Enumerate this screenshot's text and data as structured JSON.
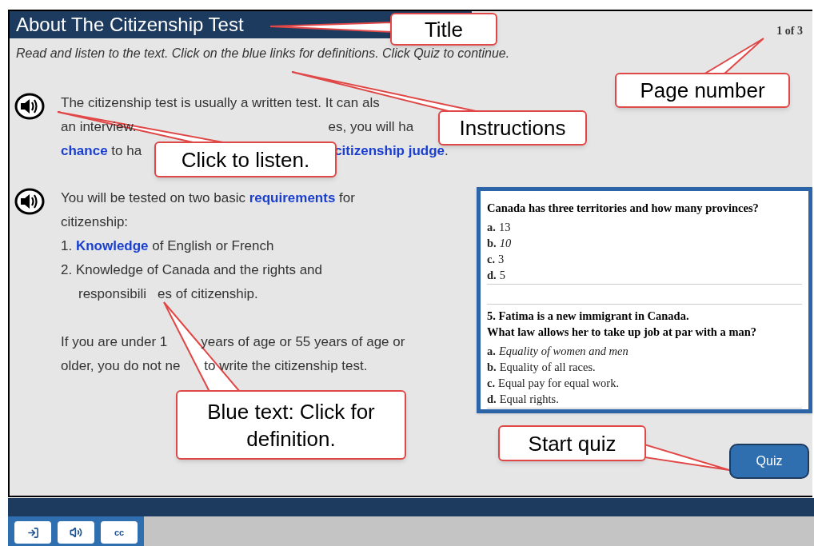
{
  "title": "About The Citizenship Test",
  "page_number": "1 of 3",
  "instructions": "Read and listen to the text. Click on the blue links for definitions. Click Quiz to continue.",
  "sections": [
    {
      "lines": [
        [
          {
            "kind": "text",
            "text": "The citizenship test is usually a written test. It can als"
          }
        ],
        [
          {
            "kind": "text",
            "text": "an interview."
          },
          {
            "kind": "text",
            "text": "es, you will ha"
          }
        ],
        [
          {
            "kind": "link",
            "text": "chance"
          },
          {
            "kind": "text",
            "text": " to ha"
          },
          {
            "kind": "link",
            "text": "citizenship judge"
          },
          {
            "kind": "text",
            "text": "."
          }
        ]
      ]
    },
    {
      "lines": [
        [
          {
            "kind": "text",
            "text": "You will be tested on two basic "
          },
          {
            "kind": "link",
            "text": "requirements"
          },
          {
            "kind": "text",
            "text": " for"
          }
        ],
        [
          {
            "kind": "text",
            "text": "citizenship:"
          }
        ],
        [
          {
            "kind": "text",
            "text": "1. "
          },
          {
            "kind": "link",
            "text": "Knowledge"
          },
          {
            "kind": "text",
            "text": " of English or French"
          }
        ],
        [
          {
            "kind": "text",
            "text": "2. Knowledge of Canada and the rights and"
          }
        ],
        [
          {
            "kind": "text",
            "text": "responsibili"
          },
          {
            "kind": "text",
            "text": "es of citizenship."
          }
        ],
        [
          {
            "kind": "text",
            "text": "If you are under 1"
          },
          {
            "kind": "text",
            "text": "years of age or 55 years of age or"
          }
        ],
        [
          {
            "kind": "text",
            "text": "older, you do not ne"
          },
          {
            "kind": "text",
            "text": "to write the citizenship test."
          }
        ]
      ]
    }
  ],
  "quiz_image": {
    "questions": [
      {
        "question": "Canada has three territories and how many provinces?",
        "options": [
          {
            "letter": "a.",
            "text": "13",
            "italic": false
          },
          {
            "letter": "b.",
            "text": "10",
            "italic": true
          },
          {
            "letter": "c.",
            "text": "3",
            "italic": false
          },
          {
            "letter": "d.",
            "text": "5",
            "italic": false
          }
        ]
      },
      {
        "question": "5. Fatima is a new immigrant in Canada.\nWhat law allows her to take up job at par with a man?",
        "options": [
          {
            "letter": "a.",
            "text": "Equality of women and men",
            "italic": true
          },
          {
            "letter": "b.",
            "text": "Equality of all races.",
            "italic": false
          },
          {
            "letter": "c.",
            "text": "Equal pay for equal work.",
            "italic": false
          },
          {
            "letter": "d.",
            "text": "Equal rights.",
            "italic": false
          }
        ]
      }
    ]
  },
  "quiz_button": "Quiz",
  "toolbar": [
    {
      "kind": "exit"
    },
    {
      "kind": "audio"
    },
    {
      "kind": "text",
      "text": "cc"
    }
  ],
  "callouts": [
    "Title",
    "Page number",
    "Instructions",
    "Click to listen.",
    "Blue text: Click for definition.",
    "Start quiz"
  ]
}
